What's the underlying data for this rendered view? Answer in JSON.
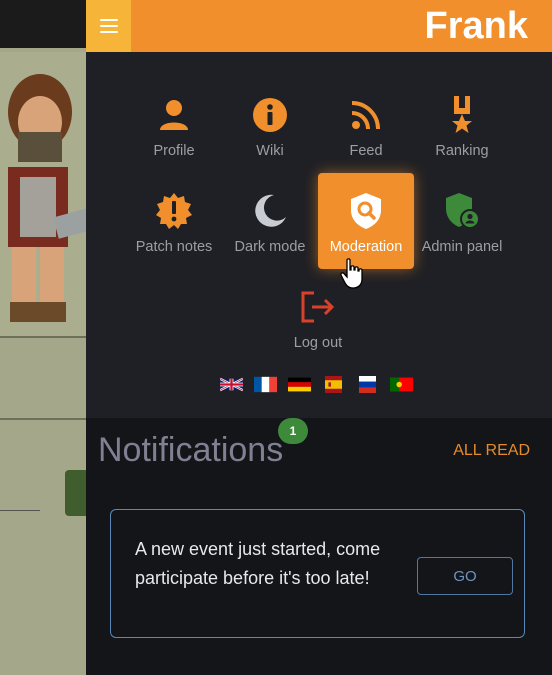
{
  "header": {
    "username": "Frank",
    "menu_icon": "hamburger-icon"
  },
  "menu": {
    "items": [
      {
        "label": "Profile",
        "icon": "user-icon"
      },
      {
        "label": "Wiki",
        "icon": "info-icon"
      },
      {
        "label": "Feed",
        "icon": "rss-icon"
      },
      {
        "label": "Ranking",
        "icon": "medal-icon"
      },
      {
        "label": "Patch notes",
        "icon": "alert-badge-icon"
      },
      {
        "label": "Dark mode",
        "icon": "moon-icon"
      },
      {
        "label": "Moderation",
        "icon": "shield-search-icon",
        "active": true
      },
      {
        "label": "Admin panel",
        "icon": "shield-user-icon"
      },
      {
        "label": "Log out",
        "icon": "logout-icon"
      }
    ]
  },
  "languages": [
    "en",
    "fr",
    "de",
    "es",
    "ru",
    "pt"
  ],
  "notifications": {
    "title": "Notifications",
    "badge_count": "1",
    "all_read_label": "ALL READ",
    "items": [
      {
        "text": "A new event just started, come participate before it's too late!",
        "action_label": "GO"
      }
    ]
  },
  "colors": {
    "accent": "#f08f2b",
    "panel_bg": "#1f2025",
    "notif_bg": "#141518",
    "card_border": "#5b88b8",
    "badge": "#3d8a3b"
  }
}
